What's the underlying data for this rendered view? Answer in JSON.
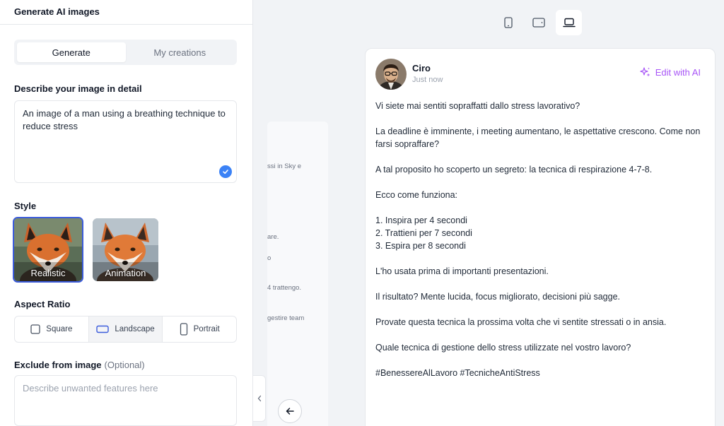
{
  "panel": {
    "title": "Generate AI images",
    "tabs": [
      {
        "label": "Generate",
        "active": true
      },
      {
        "label": "My creations",
        "active": false
      }
    ],
    "describe_label": "Describe your image in detail",
    "prompt_value": "An image of a man using a breathing technique to reduce stress",
    "style_label": "Style",
    "styles": [
      {
        "label": "Realistic",
        "selected": true
      },
      {
        "label": "Animation",
        "selected": false
      }
    ],
    "aspect_label": "Aspect Ratio",
    "aspect_options": [
      {
        "label": "Square",
        "icon": "square-icon",
        "active": false
      },
      {
        "label": "Landscape",
        "icon": "landscape-icon",
        "active": true
      },
      {
        "label": "Portrait",
        "icon": "portrait-icon",
        "active": false
      }
    ],
    "exclude_label": "Exclude from image",
    "exclude_optional": "(Optional)",
    "exclude_placeholder": "Describe unwanted features here"
  },
  "background_snippets": [
    "ssi in Sky e",
    "are.",
    "o",
    "4 trattengo.",
    "gestire team"
  ],
  "device_bar": {
    "devices": [
      {
        "name": "mobile-icon",
        "active": false
      },
      {
        "name": "tablet-icon",
        "active": false
      },
      {
        "name": "laptop-icon",
        "active": true
      }
    ]
  },
  "post": {
    "author": "Ciro",
    "time": "Just now",
    "edit_label": "Edit with AI",
    "lines": [
      "Vi siete mai sentiti sopraffatti dallo stress lavorativo?",
      "",
      "La deadline è imminente, i meeting aumentano, le aspettative crescono. Come non farsi sopraffare?",
      "",
      "A tal proposito ho scoperto un segreto: la tecnica di respirazione 4-7-8.",
      "",
      "Ecco come funziona:",
      "",
      "1. Inspira per 4 secondi",
      "2. Trattieni per 7 secondi",
      "3. Espira per 8 secondi",
      "",
      "L'ho usata prima di importanti presentazioni.",
      "",
      "Il risultato? Mente lucida, focus migliorato, decisioni più sagge.",
      "",
      "Provate questa tecnica la prossima volta che vi sentite stressati o in ansia.",
      "",
      "Quale tecnica di gestione dello stress utilizzate nel vostro lavoro?",
      "",
      "#BenessereAlLavoro #TecnicheAntiStress"
    ]
  },
  "colors": {
    "accent_blue": "#3b5bdb",
    "ai_purple": "#a855f7",
    "check_blue": "#3b82f6"
  }
}
